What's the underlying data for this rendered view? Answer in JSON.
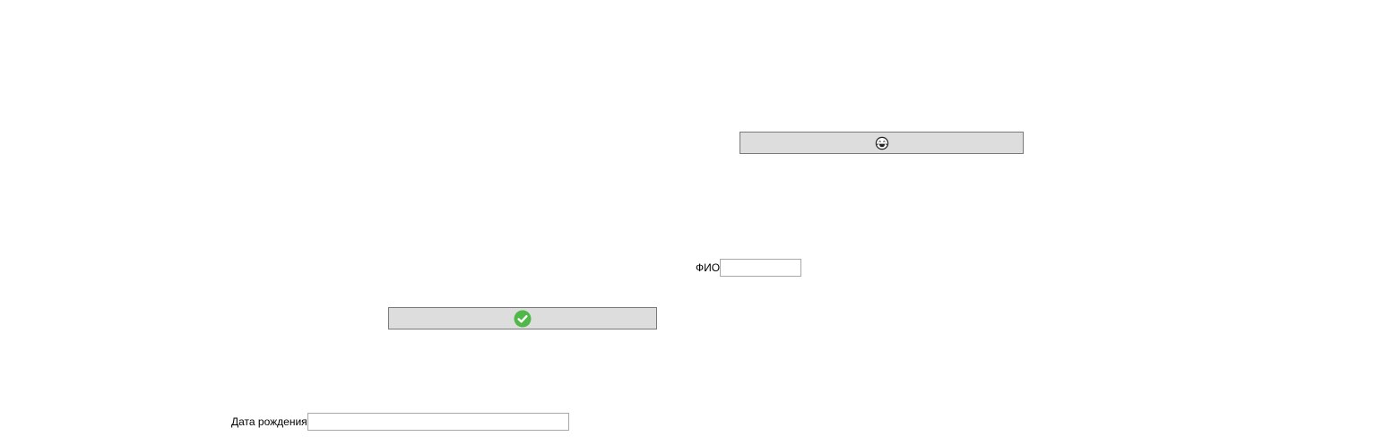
{
  "form": {
    "emoji_button": {
      "icon": "smiling-face-with-tears-icon"
    },
    "confirm_button": {
      "icon": "green-checkmark-circle-icon",
      "icon_color": "#4fb848"
    },
    "fio": {
      "label": "ФИО",
      "value": ""
    },
    "birth_date": {
      "label": "Дата рождения",
      "value": ""
    }
  },
  "colors": {
    "background": "#ffffff",
    "button_face": "#dddddd",
    "button_border": "#7a7a7a",
    "input_border": "#a8a8a8"
  }
}
